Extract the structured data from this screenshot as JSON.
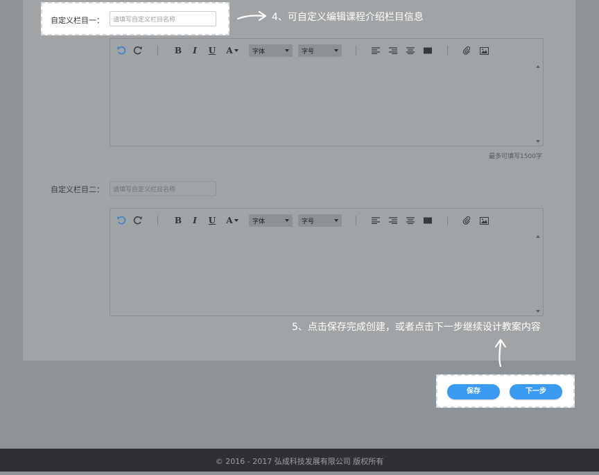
{
  "section1": {
    "label": "自定义栏目一：",
    "placeholder": "请填写自定义栏目名称"
  },
  "section2": {
    "label": "自定义栏目二：",
    "placeholder": "请填写自定义栏目名称"
  },
  "editor": {
    "bold": "B",
    "italic": "I",
    "underline": "U",
    "font_color": "A",
    "font_family": "字体",
    "font_size": "字号",
    "icons": [
      "undo-icon",
      "redo-icon",
      "align-left-icon",
      "align-right-icon",
      "align-center-icon",
      "justify-icon",
      "attachment-icon",
      "image-icon"
    ]
  },
  "char_limit_note": "最多可填写1500字",
  "annotations": {
    "step4": "4、可自定义编辑课程介绍栏目信息",
    "step5": "5、点击保存完成创建，或者点击下一步继续设计教案内容"
  },
  "actions": {
    "save": "保存",
    "next": "下一步"
  },
  "footer": "© 2016 - 2017   弘成科技发展有限公司   版权所有",
  "colors": {
    "accent": "#3a9bf0",
    "undo_icon": "#3a7fd0"
  }
}
